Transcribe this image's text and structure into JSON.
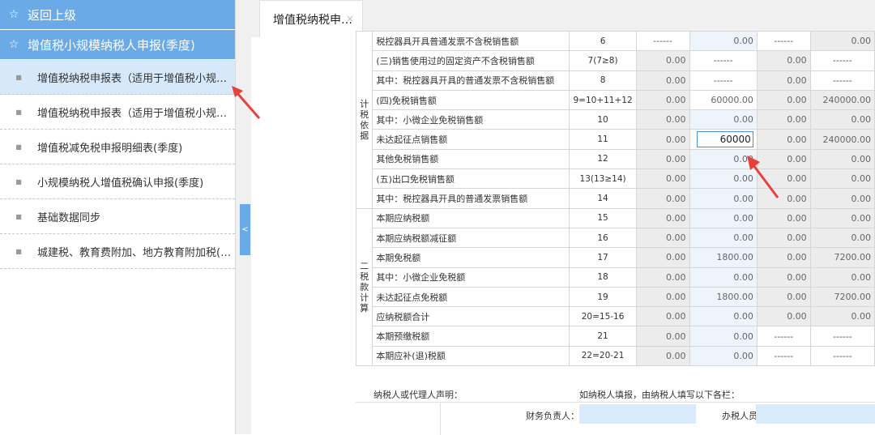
{
  "sidebar": {
    "back": {
      "icon": "star-icon",
      "label": "返回上级"
    },
    "section": {
      "icon": "star-icon",
      "label": "增值税小规模纳税人申报(季度)"
    },
    "items": [
      {
        "label": "增值税纳税申报表（适用于增值税小规模纳税人）",
        "active": true
      },
      {
        "label": "增值税纳税申报表（适用于增值税小规模纳税人）附列资料",
        "active": false
      },
      {
        "label": "增值税减免税申报明细表(季度)",
        "active": false
      },
      {
        "label": "小规模纳税人增值税确认申报(季度)",
        "active": false
      },
      {
        "label": "基础数据同步",
        "active": false
      },
      {
        "label": "城建税、教育费附加、地方教育附加税(费)申报",
        "active": false
      }
    ],
    "collapse": "<"
  },
  "tab": {
    "label": "增值税纳税申…",
    "close": "×"
  },
  "sections": {
    "jishui": "计税依据",
    "shuikuan": "二税款计算"
  },
  "rows": [
    {
      "name": "税控器具开具普通发票不含税销售额",
      "code": "6",
      "c1": "------",
      "c2": "0.00",
      "c3": "------",
      "c4": "0.00"
    },
    {
      "name": "(三)销售使用过的固定资产不含税销售额",
      "code": "7(7≥8)",
      "c1": "0.00",
      "c2": "------",
      "c3": "0.00",
      "c4": "------"
    },
    {
      "name": "其中：税控器具开具的普通发票不含税销售额",
      "code": "8",
      "c1": "0.00",
      "c2": "------",
      "c3": "0.00",
      "c4": "------"
    },
    {
      "name": "(四)免税销售额",
      "code": "9=10+11+12",
      "c1": "0.00",
      "c2": "60000.00",
      "c3": "0.00",
      "c4": "240000.00"
    },
    {
      "name": "其中：小微企业免税销售额",
      "code": "10",
      "c1": "0.00",
      "c2": "0.00",
      "c3": "0.00",
      "c4": "0.00"
    },
    {
      "name": "未达起征点销售额",
      "code": "11",
      "c1": "0.00",
      "c2": "60000",
      "c3": "0.00",
      "c4": "240000.00"
    },
    {
      "name": "其他免税销售额",
      "code": "12",
      "c1": "0.00",
      "c2": "0.00",
      "c3": "0.00",
      "c4": "0.00"
    },
    {
      "name": "(五)出口免税销售额",
      "code": "13(13≥14)",
      "c1": "0.00",
      "c2": "0.00",
      "c3": "0.00",
      "c4": "0.00"
    },
    {
      "name": "其中：税控器具开具的普通发票销售额",
      "code": "14",
      "c1": "0.00",
      "c2": "0.00",
      "c3": "0.00",
      "c4": "0.00"
    },
    {
      "name": "本期应纳税额",
      "code": "15",
      "c1": "0.00",
      "c2": "0.00",
      "c3": "0.00",
      "c4": "0.00"
    },
    {
      "name": "本期应纳税额减征额",
      "code": "16",
      "c1": "0.00",
      "c2": "0.00",
      "c3": "0.00",
      "c4": "0.00"
    },
    {
      "name": "本期免税额",
      "code": "17",
      "c1": "0.00",
      "c2": "1800.00",
      "c3": "0.00",
      "c4": "7200.00"
    },
    {
      "name": "其中：小微企业免税额",
      "code": "18",
      "c1": "0.00",
      "c2": "0.00",
      "c3": "0.00",
      "c4": "0.00"
    },
    {
      "name": "未达起征点免税额",
      "code": "19",
      "c1": "0.00",
      "c2": "1800.00",
      "c3": "0.00",
      "c4": "7200.00"
    },
    {
      "name": "应纳税额合计",
      "code": "20=15-16",
      "c1": "0.00",
      "c2": "0.00",
      "c3": "0.00",
      "c4": "0.00"
    },
    {
      "name": "本期预缴税额",
      "code": "21",
      "c1": "0.00",
      "c2": "0.00",
      "c3": "------",
      "c4": "------"
    },
    {
      "name": "本期应补(退)税额",
      "code": "22=20-21",
      "c1": "0.00",
      "c2": "0.00",
      "c3": "------",
      "c4": "------"
    }
  ],
  "footer": {
    "declaration": "纳税人或代理人声明：",
    "note": "如纳税人填报，由纳税人填写以下各栏：",
    "finance_label": "财务负责人：",
    "taxstaff_label": "办税人员："
  },
  "colors": {
    "accent": "#6aaae6",
    "active_bg": "#d6e8fa",
    "annotation": "#e8403a"
  }
}
